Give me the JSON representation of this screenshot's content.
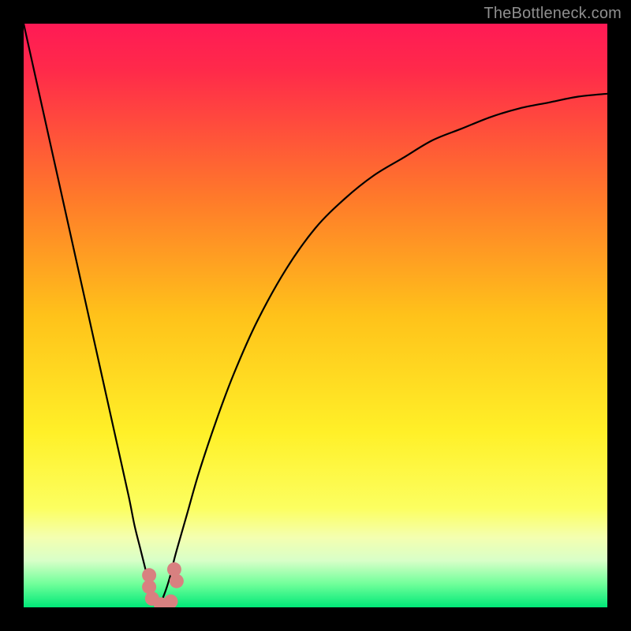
{
  "watermark": "TheBottleneck.com",
  "colors": {
    "frame": "#000000",
    "curve": "#000000",
    "annotation": "#d88080",
    "gradient_stops": [
      {
        "offset": 0,
        "color": "#ff1a55"
      },
      {
        "offset": 0.08,
        "color": "#ff2a4a"
      },
      {
        "offset": 0.3,
        "color": "#ff7a2a"
      },
      {
        "offset": 0.5,
        "color": "#ffc21a"
      },
      {
        "offset": 0.7,
        "color": "#fff028"
      },
      {
        "offset": 0.83,
        "color": "#fcff60"
      },
      {
        "offset": 0.88,
        "color": "#f4ffb0"
      },
      {
        "offset": 0.92,
        "color": "#d8ffc8"
      },
      {
        "offset": 0.96,
        "color": "#70ff9a"
      },
      {
        "offset": 1.0,
        "color": "#00e878"
      }
    ]
  },
  "chart_data": {
    "type": "line",
    "title": "",
    "xlabel": "",
    "ylabel": "",
    "x": [
      0.0,
      0.02,
      0.04,
      0.06,
      0.08,
      0.1,
      0.12,
      0.14,
      0.16,
      0.18,
      0.19,
      0.2,
      0.21,
      0.22,
      0.23,
      0.24,
      0.25,
      0.26,
      0.28,
      0.3,
      0.33,
      0.36,
      0.4,
      0.45,
      0.5,
      0.55,
      0.6,
      0.65,
      0.7,
      0.75,
      0.8,
      0.85,
      0.9,
      0.95,
      1.0
    ],
    "series": [
      {
        "name": "bottleneck-curve",
        "values": [
          1.0,
          0.91,
          0.82,
          0.73,
          0.64,
          0.55,
          0.46,
          0.37,
          0.28,
          0.19,
          0.14,
          0.1,
          0.06,
          0.02,
          0.0,
          0.02,
          0.05,
          0.09,
          0.16,
          0.23,
          0.32,
          0.4,
          0.49,
          0.58,
          0.65,
          0.7,
          0.74,
          0.77,
          0.8,
          0.82,
          0.84,
          0.855,
          0.865,
          0.875,
          0.88
        ]
      }
    ],
    "xlim": [
      0,
      1
    ],
    "ylim": [
      0,
      1
    ],
    "annotation": {
      "name": "near-minimum-cluster",
      "points": [
        {
          "x": 0.215,
          "y": 0.055
        },
        {
          "x": 0.215,
          "y": 0.035
        },
        {
          "x": 0.22,
          "y": 0.015
        },
        {
          "x": 0.235,
          "y": 0.005
        },
        {
          "x": 0.252,
          "y": 0.01
        },
        {
          "x": 0.258,
          "y": 0.065
        },
        {
          "x": 0.262,
          "y": 0.045
        }
      ]
    }
  }
}
